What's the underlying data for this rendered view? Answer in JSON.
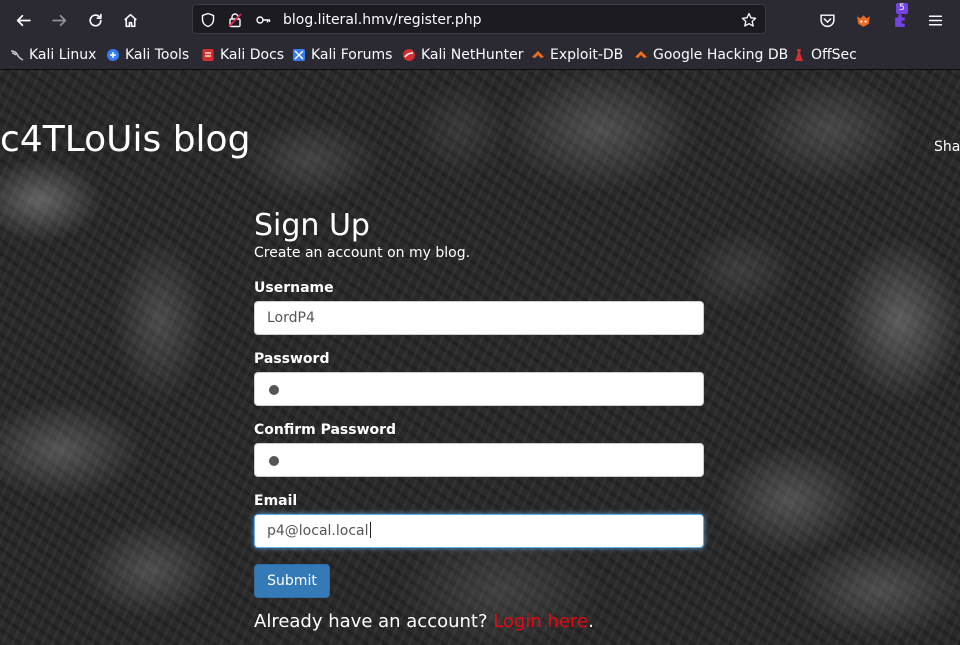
{
  "browser": {
    "url": "blog.literal.hmv/register.php",
    "extension_badge": "5"
  },
  "bookmarks": [
    {
      "label": "Kali Linux",
      "icon": "kali-dragon-icon"
    },
    {
      "label": "Kali Tools",
      "icon": "kali-tools-icon"
    },
    {
      "label": "Kali Docs",
      "icon": "kali-docs-icon"
    },
    {
      "label": "Kali Forums",
      "icon": "kali-forums-icon"
    },
    {
      "label": "Kali NetHunter",
      "icon": "nethunter-icon"
    },
    {
      "label": "Exploit-DB",
      "icon": "exploit-db-icon"
    },
    {
      "label": "Google Hacking DB",
      "icon": "ghdb-icon"
    },
    {
      "label": "OffSec",
      "icon": "offsec-icon"
    }
  ],
  "page": {
    "blog_title": "c4TLoUis blog",
    "nav_partial": "Sha",
    "form": {
      "title": "Sign Up",
      "subtitle": "Create an account on my blog.",
      "username_label": "Username",
      "username_value": "LordP4",
      "password_label": "Password",
      "confirm_label": "Confirm Password",
      "email_label": "Email",
      "email_value": "p4@local.local",
      "submit_label": "Submit",
      "login_prompt": "Already have an account? ",
      "login_link": "Login here",
      "login_suffix": "."
    }
  },
  "colors": {
    "link": "#e50914",
    "button": "#337ab7",
    "toolbar": "#2b2a33"
  }
}
